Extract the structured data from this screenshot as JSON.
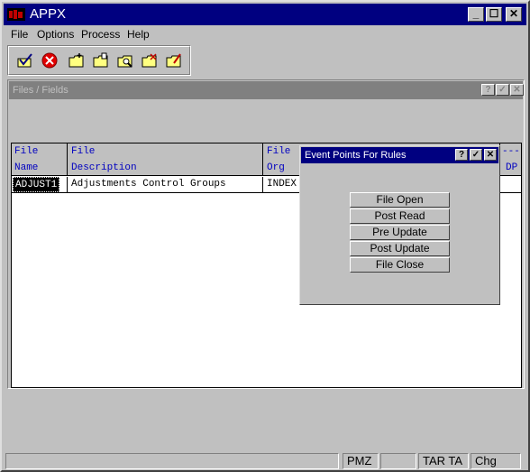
{
  "app": {
    "title": "APPX"
  },
  "menubar": [
    {
      "label": "File"
    },
    {
      "label": "Options"
    },
    {
      "label": "Process"
    },
    {
      "label": "Help"
    }
  ],
  "toolbar": {
    "tools": [
      "ok-check-icon",
      "cancel-icon",
      "new-folder-icon",
      "open-folder-icon",
      "search-folder-icon",
      "delete-folder-icon",
      "edit-folder-icon"
    ]
  },
  "child_window": {
    "title": "Files / Fields",
    "buttons": [
      "?",
      "✓",
      "✕"
    ]
  },
  "grid": {
    "columns": [
      {
        "line1": "File",
        "line2": "Name"
      },
      {
        "line1": "File",
        "line2": "Description"
      },
      {
        "line1": "File",
        "line2": "Org"
      },
      {
        "line1": "---",
        "line2": "DP"
      }
    ],
    "rows": [
      {
        "name": "ADJUST1",
        "description": "Adjustments Control Groups",
        "org": "INDEX"
      }
    ]
  },
  "dialog": {
    "title": "Event Points For Rules",
    "buttons": [
      "?",
      "✓",
      "✕"
    ],
    "events": [
      "File Open",
      "Post Read",
      "Pre Update",
      "Post Update",
      "File Close"
    ]
  },
  "statusbar": {
    "cells": [
      "",
      "PMZ",
      "",
      "TAR TA",
      "Chg"
    ]
  },
  "colors": {
    "title_active": "#000080",
    "title_inactive": "#808080",
    "header_text": "#0000c0"
  }
}
